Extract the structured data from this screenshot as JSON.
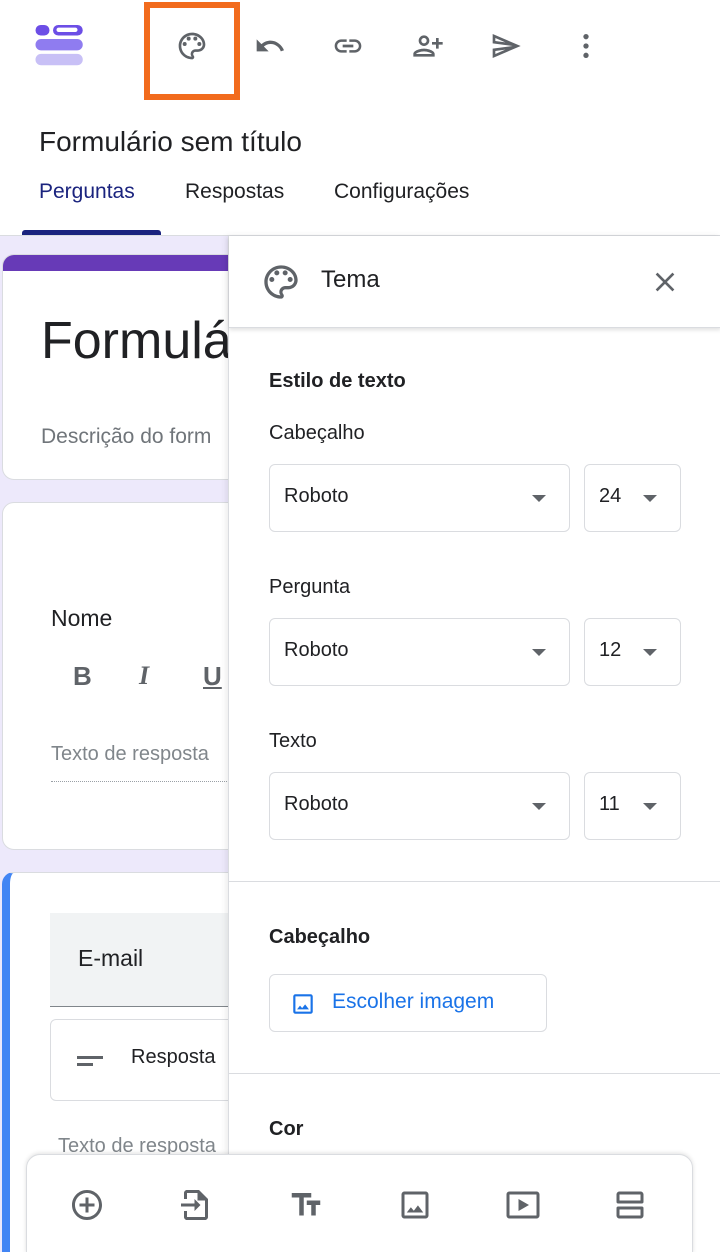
{
  "header": {
    "form_title": "Formulário sem título",
    "tabs": [
      {
        "label": "Perguntas",
        "active": true
      },
      {
        "label": "Respostas",
        "active": false
      },
      {
        "label": "Configurações",
        "active": false
      }
    ],
    "toolbar_icons": [
      "forms-logo-icon",
      "palette-icon",
      "undo-icon",
      "link-icon",
      "add-collaborator-icon",
      "send-icon",
      "more-vert-icon"
    ]
  },
  "form": {
    "title_card": {
      "title": "Formulá",
      "description": "Descrição do form"
    },
    "question1": {
      "label": "Nome",
      "format_buttons": [
        "B",
        "I",
        "U"
      ],
      "placeholder": "Texto de resposta"
    },
    "question2": {
      "label": "E-mail",
      "type_label": "Resposta",
      "placeholder": "Texto de resposta"
    }
  },
  "theme_panel": {
    "title": "Tema",
    "text_style": {
      "title": "Estilo de texto",
      "header": {
        "label": "Cabeçalho",
        "font": "Roboto",
        "size": "24"
      },
      "question": {
        "label": "Pergunta",
        "font": "Roboto",
        "size": "12"
      },
      "text": {
        "label": "Texto",
        "font": "Roboto",
        "size": "11"
      }
    },
    "header_section": {
      "title": "Cabeçalho",
      "choose_image": "Escolher imagem"
    },
    "color_section": {
      "title": "Cor"
    }
  },
  "colors": {
    "accent": "#673ab7",
    "tab_active": "#1a237e",
    "highlight": "#f26b1d",
    "link": "#1a73e8"
  }
}
